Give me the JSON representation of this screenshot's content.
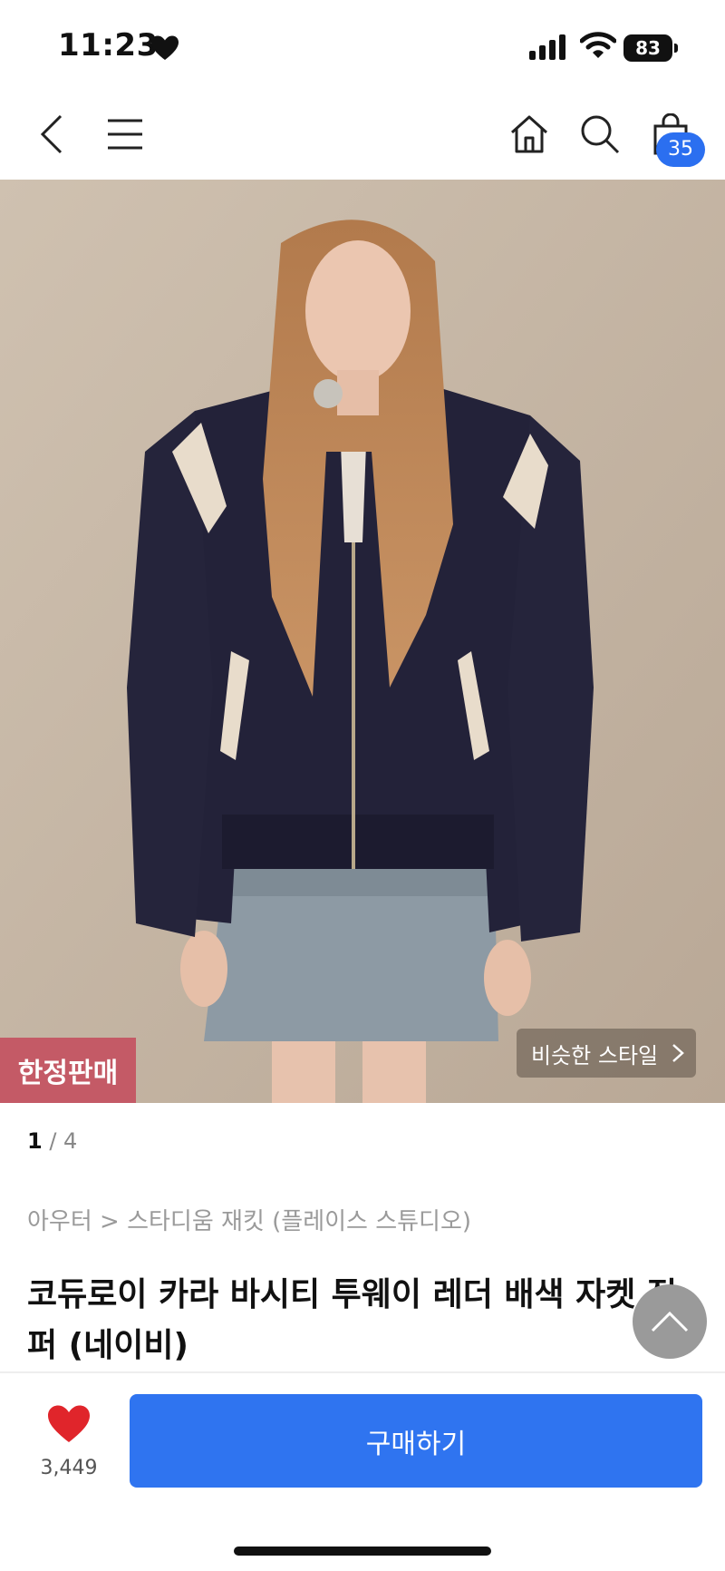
{
  "status_bar": {
    "time": "11:23",
    "battery": "83"
  },
  "nav": {
    "cart_count": "35"
  },
  "product": {
    "limited_badge": "한정판매",
    "similar_style_label": "비슷한 스타일",
    "image_index": "1",
    "image_total": "/ 4",
    "breadcrumb": "아우터 > 스타디움 재킷 (플레이스 스튜디오)",
    "title": "코듀로이 카라 바시티 투웨이 레더 배색 자켓 점퍼 (네이비)"
  },
  "bottom_bar": {
    "like_count": "3,449",
    "buy_label": "구매하기"
  },
  "colors": {
    "accent": "#2f74f0",
    "badge": "#c45a66",
    "like": "#e0252b"
  }
}
